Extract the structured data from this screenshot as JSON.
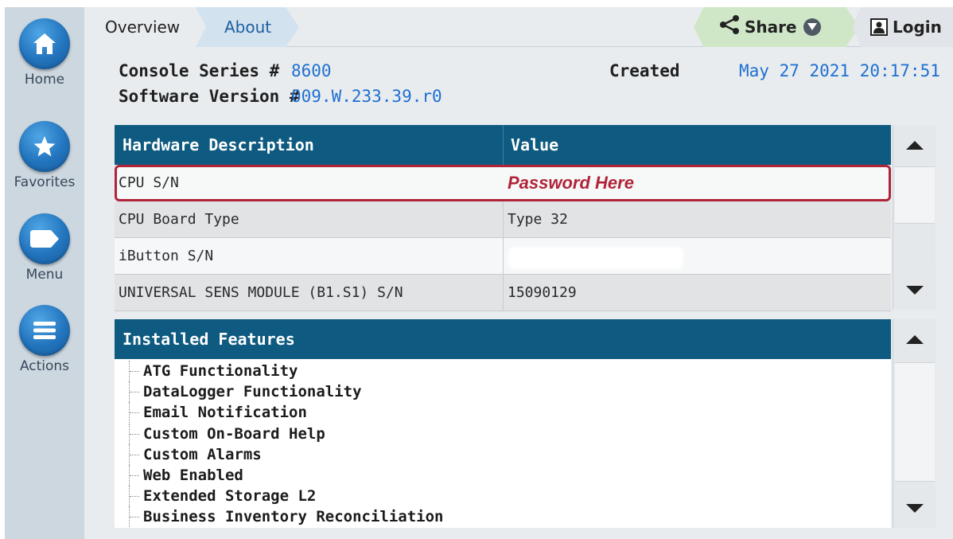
{
  "sidebar": {
    "items": [
      {
        "label": "Home",
        "icon": "home-icon"
      },
      {
        "label": "Favorites",
        "icon": "star-icon"
      },
      {
        "label": "Menu",
        "icon": "tag-icon"
      },
      {
        "label": "Actions",
        "icon": "list-icon"
      }
    ]
  },
  "tabs": {
    "overview": "Overview",
    "about": "About",
    "share": "Share",
    "login": "Login"
  },
  "info": {
    "console_label": "Console Series #",
    "console_value": "8600",
    "software_label": "Software Version #",
    "software_value": "009.W.233.39.r0",
    "created_label": "Created",
    "created_value": "May 27 2021 20:17:51"
  },
  "hardware_table": {
    "headers": [
      "Hardware Description",
      "Value"
    ],
    "rows": [
      {
        "description": "CPU S/N",
        "value": "Password Here"
      },
      {
        "description": "CPU Board Type",
        "value": "Type 32"
      },
      {
        "description": "iButton S/N",
        "value": ""
      },
      {
        "description": "UNIVERSAL SENS MODULE (B1.S1) S/N",
        "value": "15090129"
      }
    ]
  },
  "features_table": {
    "header": "Installed Features",
    "items": [
      "ATG Functionality",
      "DataLogger Functionality",
      "Email Notification",
      "Custom On-Board Help",
      "Custom Alarms",
      "Web Enabled",
      "Extended Storage L2",
      "Business Inventory Reconciliation"
    ]
  },
  "colors": {
    "accent_blue": "#1f6fd0",
    "header_teal": "#0e5a80",
    "highlight_red": "#b0243a",
    "share_green": "#cfe7c7"
  }
}
